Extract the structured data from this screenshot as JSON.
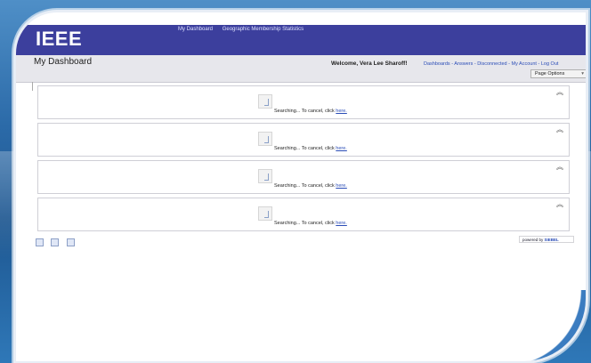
{
  "header": {
    "logo_text": "IEEE",
    "nav_items": [
      "My Dashboard",
      "Geographic Membership Statistics"
    ]
  },
  "subheader": {
    "title": "My Dashboard",
    "welcome": "Welcome, Vera Lee Sharoff!",
    "links": [
      "Dashboards",
      "Answers",
      "Disconnected",
      "My Account",
      "Log Out"
    ],
    "page_options_label": "Page Options"
  },
  "sections": [
    {
      "status": "Searching... To cancel, click",
      "cancel_link": "here."
    },
    {
      "status": "Searching... To cancel, click",
      "cancel_link": "here."
    },
    {
      "status": "Searching... To cancel, click",
      "cancel_link": "here."
    },
    {
      "status": "Searching... To cancel, click",
      "cancel_link": "here."
    }
  ],
  "footer": {
    "powered_by_prefix": "powered by",
    "powered_by_brand": "SIEBEL"
  }
}
